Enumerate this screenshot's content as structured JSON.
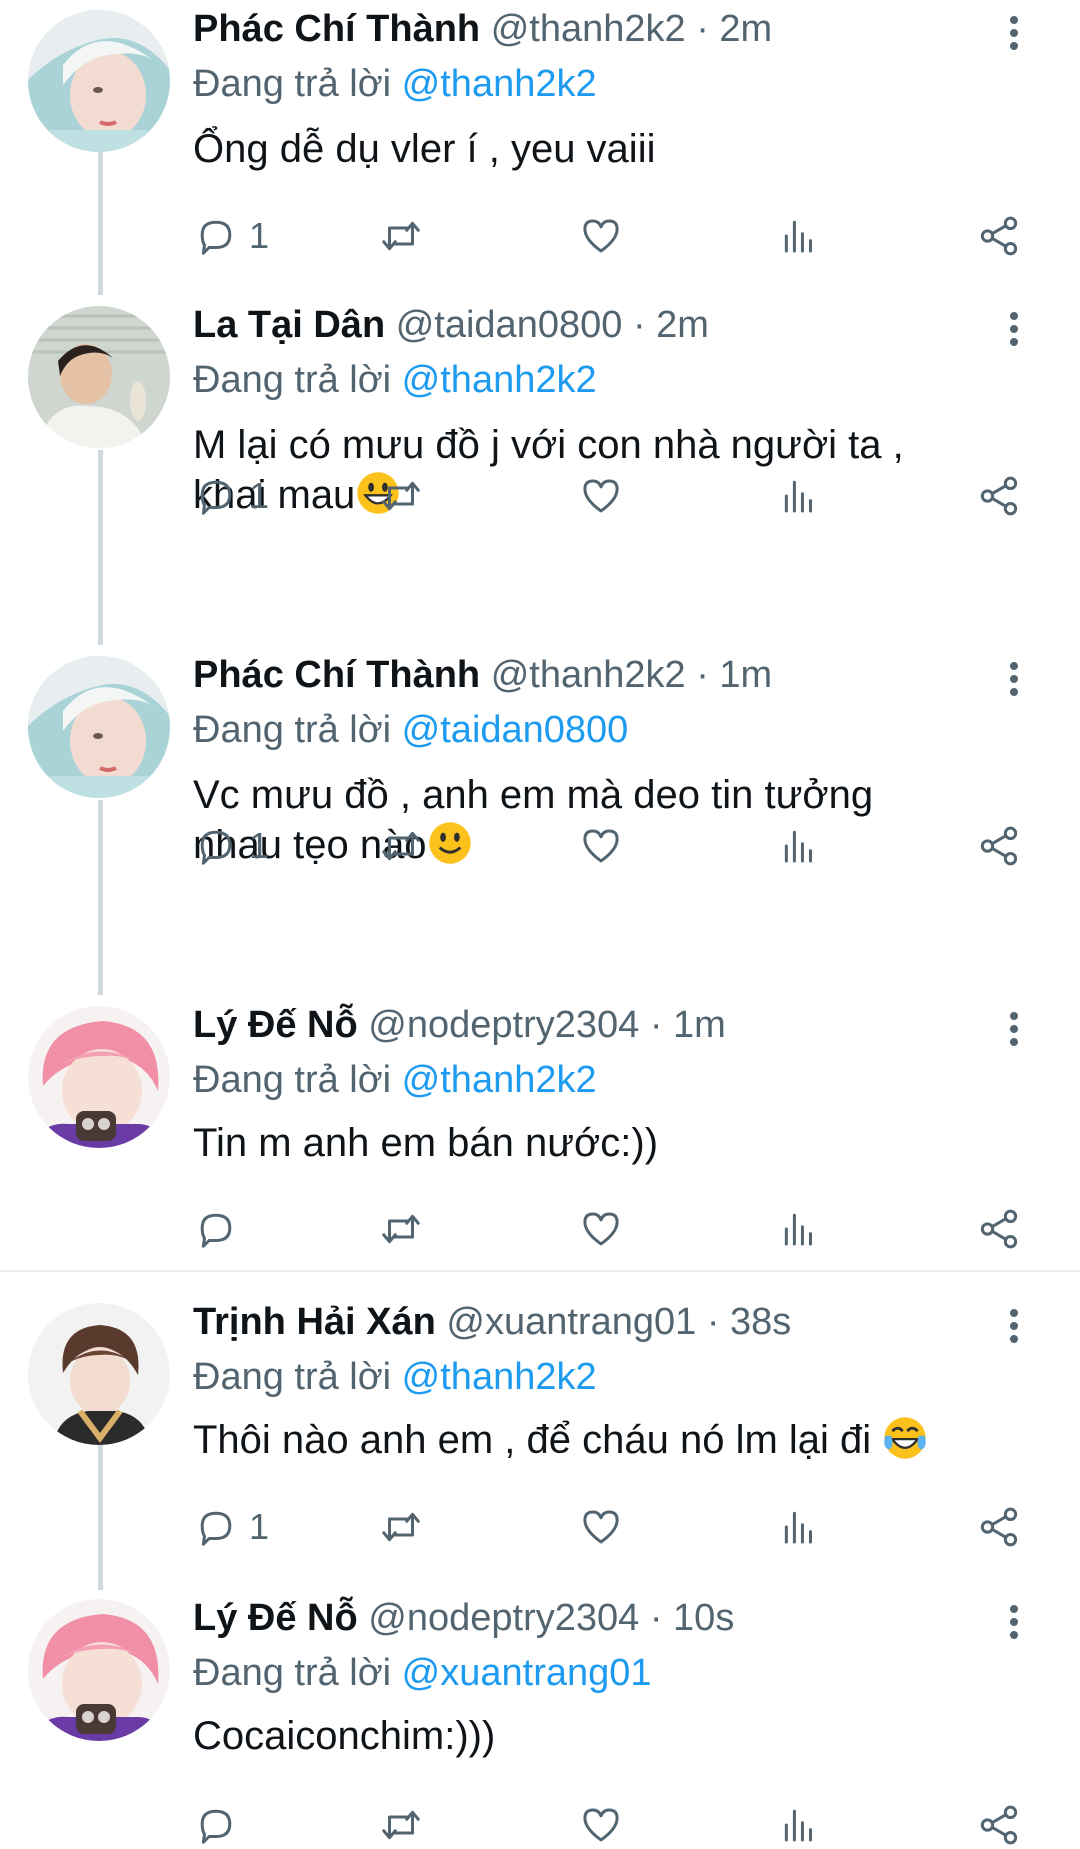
{
  "replying_prefix": "Đang trả lời",
  "tweets": [
    {
      "name": "Phác Chí Thành",
      "handle": "@thanh2k2",
      "time": "2m",
      "reply_to": "@thanh2k2",
      "text": "Ổng dễ dụ vler í , yeu vaiii",
      "text2": "",
      "reply_count": "1",
      "avatar": "avatar-pale-hair"
    },
    {
      "name": "La Tại Dân",
      "handle": "@taidan0800",
      "time": "2m",
      "reply_to": "@thanh2k2",
      "text": "M lại có mưu đồ j với con nhà người ta ,",
      "text2": "khai mau",
      "text2_emoji": "😀",
      "reply_count": "1",
      "avatar": "avatar-dark-hair"
    },
    {
      "name": "Phác Chí Thành",
      "handle": "@thanh2k2",
      "time": "1m",
      "reply_to": "@taidan0800",
      "text": "Vc mưu đồ , anh em mà deo tin tưởng",
      "text2": "nhau tẹo nào",
      "text2_emoji": "🙂",
      "reply_count": "1",
      "avatar": "avatar-pale-hair"
    },
    {
      "name": "Lý Đế Nỗ",
      "handle": "@nodeptry2304",
      "time": "1m",
      "reply_to": "@thanh2k2",
      "text": "Tin m anh em bán nước:))",
      "text2": "",
      "reply_count": "",
      "avatar": "avatar-pink-hair"
    },
    {
      "name": "Trịnh Hải Xán",
      "handle": "@xuantrang01",
      "time": "38s",
      "reply_to": "@thanh2k2",
      "text": "Thôi nào anh em , để cháu nó lm lại đi ",
      "text_emoji": "😂",
      "text2": "",
      "reply_count": "1",
      "avatar": "avatar-brown-hair"
    },
    {
      "name": "Lý Đế Nỗ",
      "handle": "@nodeptry2304",
      "time": "10s",
      "reply_to": "@xuantrang01",
      "text": "Cocaiconchim:)))",
      "text2": "",
      "reply_count": "",
      "avatar": "avatar-pink-hair"
    }
  ],
  "icons": {
    "reply": "reply-icon",
    "retweet": "retweet-icon",
    "like": "like-icon",
    "views": "views-icon",
    "share": "share-icon",
    "more": "more-vertical-icon"
  },
  "colors": {
    "accent": "#1d9bf0",
    "secondary_text": "#536471",
    "thread_line": "#cfd9de"
  }
}
